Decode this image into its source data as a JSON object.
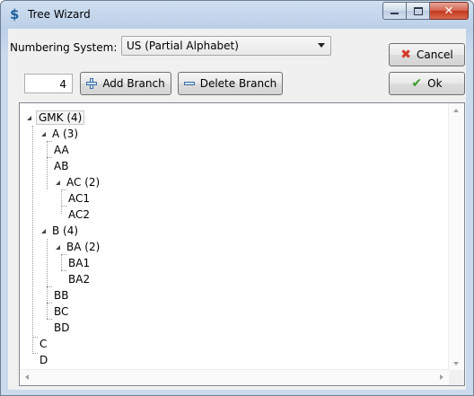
{
  "window": {
    "title": "Tree Wizard",
    "icon": "tree-wizard-app-icon",
    "accent": "#1f5f99"
  },
  "numbering": {
    "label": "Numbering System:",
    "selected": "US (Partial Alphabet)"
  },
  "spinner": {
    "value": "4"
  },
  "buttons": {
    "add_branch": "Add Branch",
    "delete_branch": "Delete Branch",
    "cancel": "Cancel",
    "ok": "Ok"
  },
  "tree": {
    "nodes": [
      {
        "id": "gmk",
        "label": "GMK (4)",
        "expanded": true,
        "selected": true
      },
      {
        "id": "a",
        "label": "A (3)",
        "expanded": true
      },
      {
        "id": "aa",
        "label": "AA"
      },
      {
        "id": "ab",
        "label": "AB"
      },
      {
        "id": "ac",
        "label": "AC (2)",
        "expanded": true
      },
      {
        "id": "ac1",
        "label": "AC1"
      },
      {
        "id": "ac2",
        "label": "AC2"
      },
      {
        "id": "b",
        "label": "B (4)",
        "expanded": true
      },
      {
        "id": "ba",
        "label": "BA (2)",
        "expanded": true
      },
      {
        "id": "ba1",
        "label": "BA1"
      },
      {
        "id": "ba2",
        "label": "BA2"
      },
      {
        "id": "bb",
        "label": "BB"
      },
      {
        "id": "bc",
        "label": "BC"
      },
      {
        "id": "bd",
        "label": "BD"
      },
      {
        "id": "c",
        "label": "C"
      },
      {
        "id": "d",
        "label": "D"
      }
    ]
  }
}
